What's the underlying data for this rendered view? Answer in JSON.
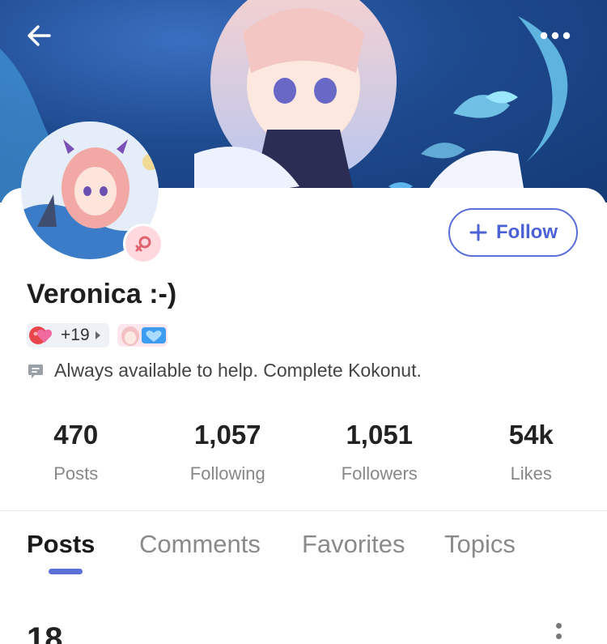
{
  "header": {
    "back_icon": "arrow-left-icon",
    "more_icon": "more-horizontal-icon"
  },
  "profile": {
    "name": "Veronica :-)",
    "follow_label": "Follow",
    "follow_icon": "plus-icon",
    "gender_icon": "female-icon",
    "badge_count": "+19",
    "bio": "Always available to help.  Complete Kokonut.",
    "bio_icon": "chat-bubble-icon"
  },
  "stats": [
    {
      "value": "470",
      "label": "Posts"
    },
    {
      "value": "1,057",
      "label": "Following"
    },
    {
      "value": "1,051",
      "label": "Followers"
    },
    {
      "value": "54k",
      "label": "Likes"
    }
  ],
  "tabs": [
    {
      "label": "Posts",
      "active": true
    },
    {
      "label": "Comments",
      "active": false
    },
    {
      "label": "Favorites",
      "active": false
    },
    {
      "label": "Topics",
      "active": false
    }
  ],
  "post_preview": {
    "count": "18"
  },
  "colors": {
    "accent": "#5b6fd8",
    "banner": "#1e4a8f",
    "badge_bg": "#eef1f6"
  }
}
